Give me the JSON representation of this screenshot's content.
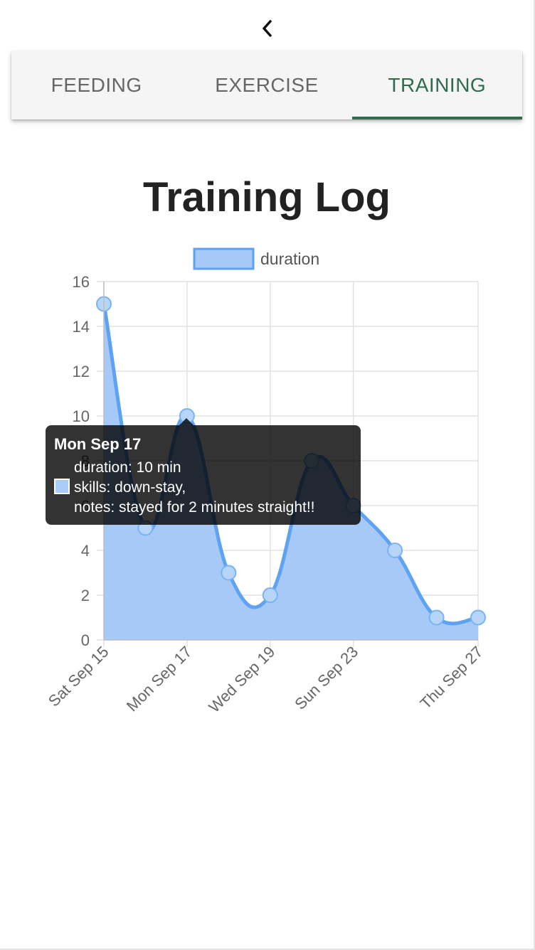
{
  "tabs": [
    {
      "label": "FEEDING",
      "active": false
    },
    {
      "label": "EXERCISE",
      "active": false
    },
    {
      "label": "TRAINING",
      "active": true
    }
  ],
  "colors": {
    "accent": "#2e6b4f",
    "series_fill": "#a6c9f7",
    "series_line": "#5ea2f2"
  },
  "icons": {
    "back": "chevron-left-icon"
  },
  "page": {
    "title": "Training Log"
  },
  "chart_data": {
    "type": "area",
    "title": "",
    "xlabel": "",
    "ylabel": "",
    "legend": {
      "position": "top",
      "entries": [
        "duration"
      ]
    },
    "grid": true,
    "ylim": [
      0,
      16
    ],
    "y_ticks": [
      "0",
      "2",
      "4",
      "6",
      "8",
      "10",
      "12",
      "14",
      "16"
    ],
    "x_tick_labels": [
      "Sat Sep 15",
      "Mon Sep 17",
      "Wed Sep 19",
      "Sun Sep 23",
      "Thu Sep 27"
    ],
    "x_tick_positions": [
      0,
      2,
      4,
      6,
      9
    ],
    "series": [
      {
        "name": "duration",
        "x_index": [
          0,
          1,
          2,
          3,
          4,
          5,
          6,
          7,
          8,
          9
        ],
        "values": [
          15,
          5,
          10,
          3,
          2,
          8,
          6,
          4,
          1,
          1
        ]
      }
    ],
    "tooltip": {
      "title": "Mon Sep 17",
      "lines": [
        "duration: 10 min",
        "skills: down-stay,",
        "notes: stayed for 2 minutes straight!!"
      ]
    }
  }
}
